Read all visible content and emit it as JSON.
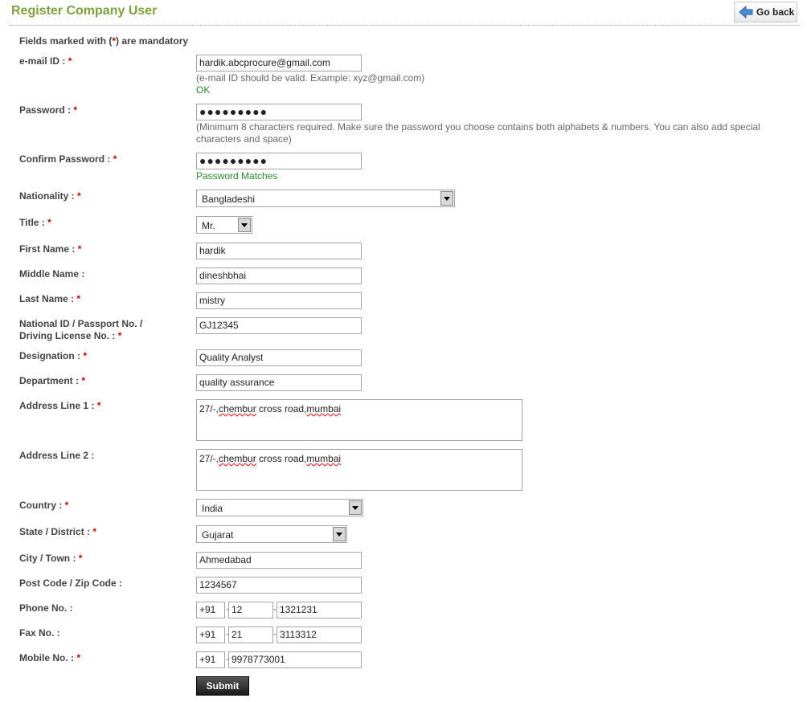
{
  "page": {
    "title": "Register Company User",
    "go_back": "Go back",
    "mandatory_prefix": "Fields marked with (",
    "mandatory_star": "*",
    "mandatory_suffix": ") are mandatory"
  },
  "form": {
    "email": {
      "label": "e-mail ID :",
      "value": "hardik.abcprocure@gmail.com",
      "hint": "(e-mail ID should be valid. Example: xyz@gmail.com)",
      "status": "OK"
    },
    "password": {
      "label": "Password :",
      "value": "●●●●●●●●●",
      "hint": "(Minimum 8 characters required. Make sure the password you choose contains both alphabets & numbers. You can also add special characters and space)"
    },
    "confirm_password": {
      "label": "Confirm Password :",
      "value": "●●●●●●●●●",
      "status": "Password Matches"
    },
    "nationality": {
      "label": "Nationality :",
      "value": "Bangladeshi"
    },
    "title_field": {
      "label": "Title :",
      "value": "Mr."
    },
    "first_name": {
      "label": "First Name :",
      "value": "hardik"
    },
    "middle_name": {
      "label": "Middle Name :",
      "value": "dineshbhai"
    },
    "last_name": {
      "label": "Last Name :",
      "value": "mistry"
    },
    "national_id": {
      "label_line1": "National ID / Passport No. /",
      "label_line2": "Driving License No. :",
      "value": "GJ12345"
    },
    "designation": {
      "label": "Designation :",
      "value": "Quality Analyst"
    },
    "department": {
      "label": "Department :",
      "value": "quality assurance"
    },
    "address1": {
      "label": "Address Line 1 :",
      "value_prefix": "27/-,",
      "value_word1": "chembur",
      "value_mid": " cross road,",
      "value_word2": "mumbai"
    },
    "address2": {
      "label": "Address Line 2 :",
      "value_prefix": "27/-,",
      "value_word1": "chembur",
      "value_mid": " cross road,",
      "value_word2": "mumbai"
    },
    "country": {
      "label": "Country :",
      "value": "India"
    },
    "state": {
      "label": "State / District :",
      "value": "Gujarat"
    },
    "city": {
      "label": "City / Town :",
      "value": "Ahmedabad"
    },
    "post_code": {
      "label": "Post Code / Zip Code :",
      "value": "1234567"
    },
    "phone": {
      "label": "Phone No. :",
      "country_code": "+91",
      "area_code": "12",
      "number": "1321231"
    },
    "fax": {
      "label": "Fax No. :",
      "country_code": "+91",
      "area_code": "21",
      "number": "3113312"
    },
    "mobile": {
      "label": "Mobile No. :",
      "country_code": "+91",
      "number": "9978773001"
    },
    "required_mark": "*",
    "dash": "-",
    "submit": "Submit"
  },
  "colors": {
    "title_green": "#7ba23a",
    "required_red": "#cc0000",
    "ok_green": "#2a8a2a"
  },
  "icons": {
    "go_back": "left-arrow-icon",
    "dropdown": "triangle-down-icon"
  }
}
